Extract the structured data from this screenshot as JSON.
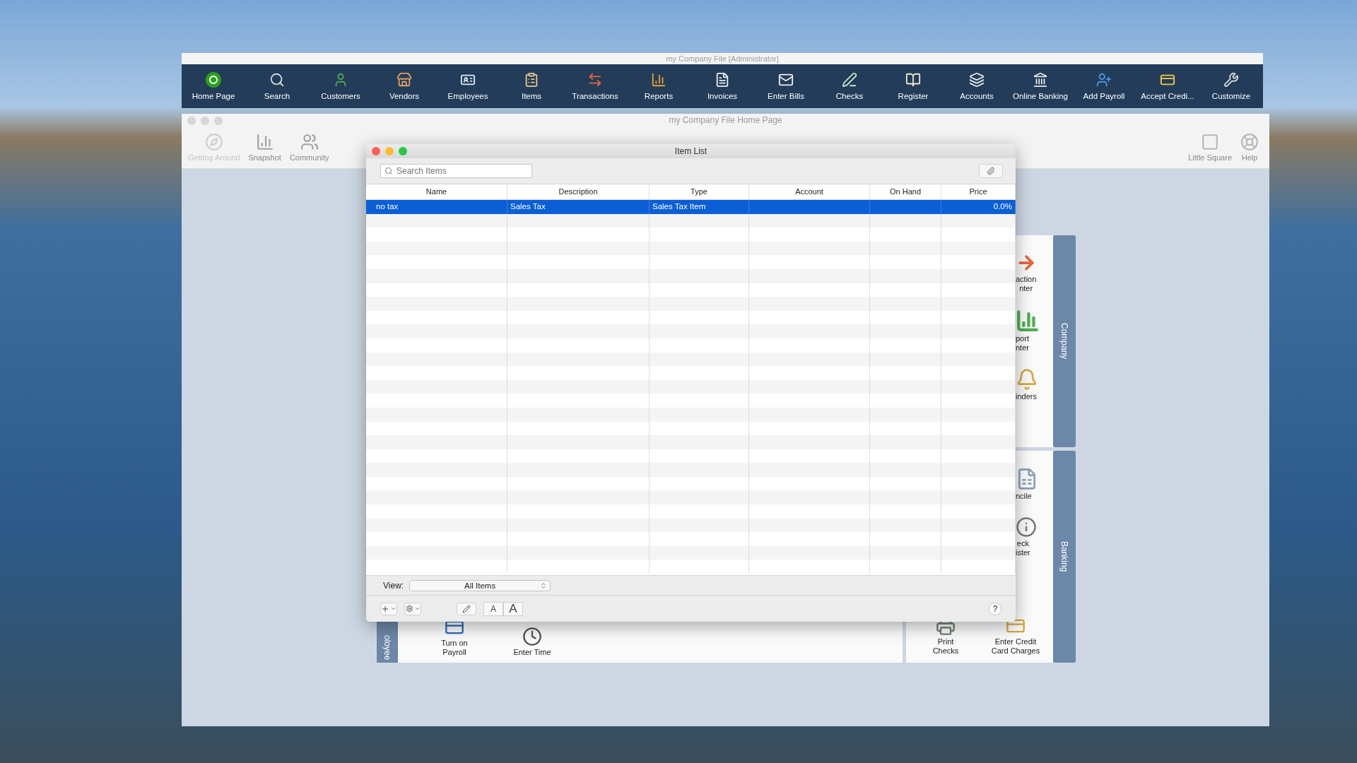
{
  "main_window": {
    "title": "my Company File [Administrator]",
    "toolbar": [
      {
        "label": "Home Page"
      },
      {
        "label": "Search"
      },
      {
        "label": "Customers"
      },
      {
        "label": "Vendors"
      },
      {
        "label": "Employees"
      },
      {
        "label": "Items"
      },
      {
        "label": "Transactions"
      },
      {
        "label": "Reports"
      },
      {
        "label": "Invoices"
      },
      {
        "label": "Enter Bills"
      },
      {
        "label": "Checks"
      },
      {
        "label": "Register"
      },
      {
        "label": "Accounts"
      },
      {
        "label": "Online Banking"
      },
      {
        "label": "Add Payroll"
      },
      {
        "label": "Accept Credi..."
      },
      {
        "label": "Customize"
      }
    ]
  },
  "home_window": {
    "title": "my Company File Home Page",
    "toolbar_left": [
      {
        "label": "Getting Around",
        "disabled": true
      },
      {
        "label": "Snapshot",
        "disabled": false
      },
      {
        "label": "Community",
        "disabled": false
      }
    ],
    "toolbar_right": [
      {
        "label": "Little Square"
      },
      {
        "label": "Help"
      }
    ],
    "company_panel": {
      "tab": "Company",
      "items": [
        {
          "lines": [
            "action",
            "nter"
          ]
        },
        {
          "lines": [
            "port",
            "nter"
          ]
        },
        {
          "lines": [
            "inders"
          ]
        }
      ]
    },
    "banking_panel": {
      "tab": "Banking",
      "items": [
        {
          "lines": [
            "ncile"
          ]
        },
        {
          "lines": [
            "eck",
            "ister"
          ]
        }
      ],
      "bottom_items": [
        {
          "lines": [
            "Print",
            "Checks"
          ]
        },
        {
          "lines": [
            "Enter Credit",
            "Card Charges"
          ]
        }
      ]
    },
    "employee_panel": {
      "tab": "oloyee",
      "items": [
        {
          "lines": [
            "Turn on",
            "Payroll"
          ]
        },
        {
          "lines": [
            "Enter Time"
          ]
        }
      ]
    }
  },
  "item_list": {
    "title": "Item List",
    "search": {
      "placeholder": "Search Items"
    },
    "columns": [
      "Name",
      "Description",
      "Type",
      "Account",
      "On Hand",
      "Price"
    ],
    "rows": [
      {
        "cells": [
          "no tax",
          "Sales Tax",
          "Sales Tax Item",
          "",
          "",
          "0.0%"
        ],
        "selected": true
      }
    ],
    "view": {
      "label": "View:",
      "value": "All Items"
    },
    "font_buttons": [
      "A",
      "A"
    ],
    "help": "?"
  }
}
